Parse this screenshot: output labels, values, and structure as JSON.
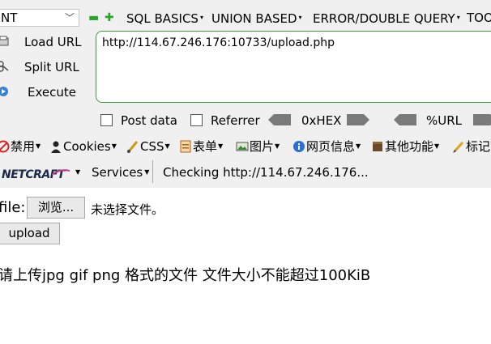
{
  "toolbar": {
    "select_value": "NT",
    "plus_minus": {
      "minus": "▬",
      "plus": "✚"
    },
    "menus": [
      {
        "label": "SQL BASICS"
      },
      {
        "label": "UNION BASED"
      },
      {
        "label": "ERROR/DOUBLE QUERY"
      },
      {
        "label": "TOO"
      }
    ],
    "left_buttons": [
      {
        "label": "Load URL",
        "icon": "load-url-icon"
      },
      {
        "label": "Split URL",
        "icon": "split-url-icon"
      },
      {
        "label": "Execute",
        "icon": "execute-icon"
      }
    ],
    "url_value": "http://114.67.246.176:10733/upload.php",
    "checkboxes": [
      {
        "label": "Post data",
        "checked": false
      },
      {
        "label": "Referrer",
        "checked": false
      }
    ],
    "encoders": [
      {
        "label": "0xHEX"
      },
      {
        "label": "%URL"
      }
    ]
  },
  "extensions": [
    {
      "label": "禁用",
      "icon": "disable-icon"
    },
    {
      "label": "Cookies",
      "icon": "cookies-icon"
    },
    {
      "label": "CSS",
      "icon": "css-icon"
    },
    {
      "label": "表单",
      "icon": "form-icon"
    },
    {
      "label": "图片",
      "icon": "image-icon"
    },
    {
      "label": "网页信息",
      "icon": "info-icon"
    },
    {
      "label": "其他功能",
      "icon": "misc-icon"
    },
    {
      "label": "标记",
      "icon": "pencil-icon"
    }
  ],
  "netcraft_row": {
    "logo": "NETCRAFT",
    "services": "Services",
    "status": "Checking http://114.67.246.176..."
  },
  "page": {
    "file_label": "file:",
    "browse_label": "浏览...",
    "no_file": "未选择文件。",
    "upload_label": "upload",
    "notice": "请上传jpg gif png 格式的文件 文件大小不能超过100KiB"
  },
  "colors": {
    "toolbar_bg": "#f0f0f0",
    "url_border": "#3c9c3c",
    "plus_minus": "#2aa52a"
  }
}
